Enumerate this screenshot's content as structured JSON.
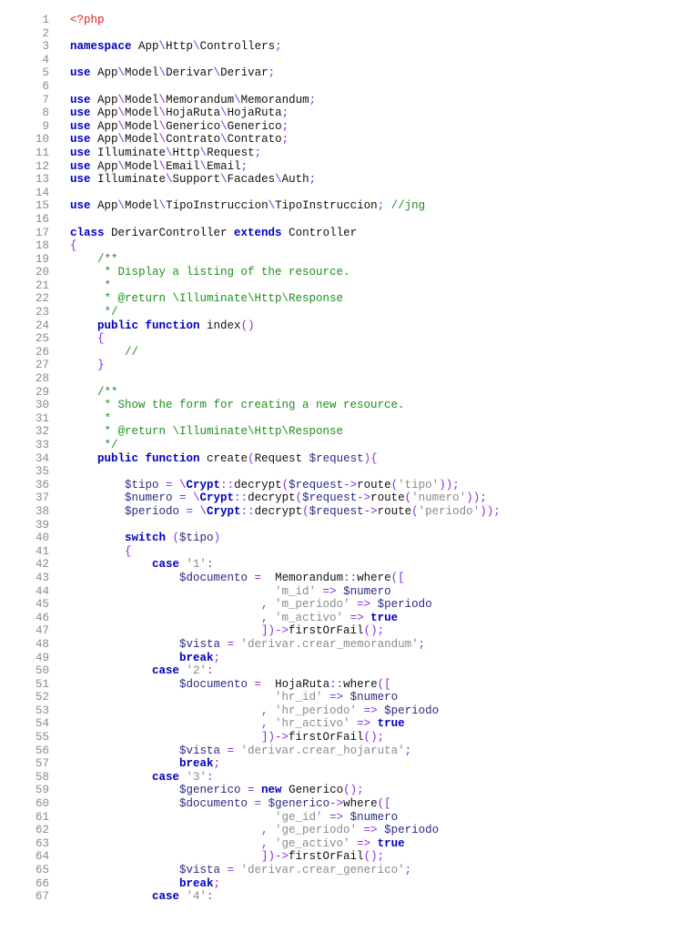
{
  "document": {
    "language": "php",
    "lines": [
      [
        [
          "h",
          "<?php"
        ]
      ],
      [],
      [
        [
          "k",
          "namespace"
        ],
        [
          "t",
          " App"
        ],
        [
          "p",
          "\\"
        ],
        [
          "t",
          "Http"
        ],
        [
          "p",
          "\\"
        ],
        [
          "t",
          "Controllers"
        ],
        [
          "p",
          ";"
        ]
      ],
      [],
      [
        [
          "k",
          "use"
        ],
        [
          "t",
          " App"
        ],
        [
          "p",
          "\\"
        ],
        [
          "t",
          "Model"
        ],
        [
          "p",
          "\\"
        ],
        [
          "t",
          "Derivar"
        ],
        [
          "p",
          "\\"
        ],
        [
          "t",
          "Derivar"
        ],
        [
          "p",
          ";"
        ]
      ],
      [],
      [
        [
          "k",
          "use"
        ],
        [
          "t",
          " App"
        ],
        [
          "p",
          "\\"
        ],
        [
          "t",
          "Model"
        ],
        [
          "p",
          "\\"
        ],
        [
          "t",
          "Memorandum"
        ],
        [
          "p",
          "\\"
        ],
        [
          "t",
          "Memorandum"
        ],
        [
          "p",
          ";"
        ]
      ],
      [
        [
          "k",
          "use"
        ],
        [
          "t",
          " App"
        ],
        [
          "p",
          "\\"
        ],
        [
          "t",
          "Model"
        ],
        [
          "p",
          "\\"
        ],
        [
          "t",
          "HojaRuta"
        ],
        [
          "p",
          "\\"
        ],
        [
          "t",
          "HojaRuta"
        ],
        [
          "p",
          ";"
        ]
      ],
      [
        [
          "k",
          "use"
        ],
        [
          "t",
          " App"
        ],
        [
          "p",
          "\\"
        ],
        [
          "t",
          "Model"
        ],
        [
          "p",
          "\\"
        ],
        [
          "t",
          "Generico"
        ],
        [
          "p",
          "\\"
        ],
        [
          "t",
          "Generico"
        ],
        [
          "p",
          ";"
        ]
      ],
      [
        [
          "k",
          "use"
        ],
        [
          "t",
          " App"
        ],
        [
          "p",
          "\\"
        ],
        [
          "t",
          "Model"
        ],
        [
          "p",
          "\\"
        ],
        [
          "t",
          "Contrato"
        ],
        [
          "p",
          "\\"
        ],
        [
          "t",
          "Contrato"
        ],
        [
          "p",
          ";"
        ]
      ],
      [
        [
          "k",
          "use"
        ],
        [
          "t",
          " Illuminate"
        ],
        [
          "p",
          "\\"
        ],
        [
          "t",
          "Http"
        ],
        [
          "p",
          "\\"
        ],
        [
          "t",
          "Request"
        ],
        [
          "p",
          ";"
        ]
      ],
      [
        [
          "k",
          "use"
        ],
        [
          "t",
          " App"
        ],
        [
          "p",
          "\\"
        ],
        [
          "t",
          "Model"
        ],
        [
          "p",
          "\\"
        ],
        [
          "t",
          "Email"
        ],
        [
          "p",
          "\\"
        ],
        [
          "t",
          "Email"
        ],
        [
          "p",
          ";"
        ]
      ],
      [
        [
          "k",
          "use"
        ],
        [
          "t",
          " Illuminate"
        ],
        [
          "p",
          "\\"
        ],
        [
          "t",
          "Support"
        ],
        [
          "p",
          "\\"
        ],
        [
          "t",
          "Facades"
        ],
        [
          "p",
          "\\"
        ],
        [
          "t",
          "Auth"
        ],
        [
          "p",
          ";"
        ]
      ],
      [],
      [
        [
          "k",
          "use"
        ],
        [
          "t",
          " App"
        ],
        [
          "p",
          "\\"
        ],
        [
          "t",
          "Model"
        ],
        [
          "p",
          "\\"
        ],
        [
          "t",
          "TipoInstruccion"
        ],
        [
          "p",
          "\\"
        ],
        [
          "t",
          "TipoInstruccion"
        ],
        [
          "p",
          "; "
        ],
        [
          "c",
          "//jng"
        ]
      ],
      [],
      [
        [
          "k",
          "class"
        ],
        [
          "t",
          " DerivarController "
        ],
        [
          "k",
          "extends"
        ],
        [
          "t",
          " Controller"
        ]
      ],
      [
        [
          "p",
          "{"
        ]
      ],
      [
        [
          "c",
          "    /**"
        ]
      ],
      [
        [
          "c",
          "     * Display a listing of the resource."
        ]
      ],
      [
        [
          "c",
          "     *"
        ]
      ],
      [
        [
          "c",
          "     * @return \\Illuminate\\Http\\Response"
        ]
      ],
      [
        [
          "c",
          "     */"
        ]
      ],
      [
        [
          "k",
          "    public"
        ],
        [
          "t",
          " "
        ],
        [
          "k",
          "function"
        ],
        [
          "t",
          " index"
        ],
        [
          "p",
          "()"
        ]
      ],
      [
        [
          "p",
          "    {"
        ]
      ],
      [
        [
          "c",
          "        //"
        ]
      ],
      [
        [
          "p",
          "    }"
        ]
      ],
      [],
      [
        [
          "c",
          "    /**"
        ]
      ],
      [
        [
          "c",
          "     * Show the form for creating a new resource."
        ]
      ],
      [
        [
          "c",
          "     *"
        ]
      ],
      [
        [
          "c",
          "     * @return \\Illuminate\\Http\\Response"
        ]
      ],
      [
        [
          "c",
          "     */"
        ]
      ],
      [
        [
          "k",
          "    public"
        ],
        [
          "t",
          " "
        ],
        [
          "k",
          "function"
        ],
        [
          "t",
          " create"
        ],
        [
          "p",
          "("
        ],
        [
          "t",
          "Request "
        ],
        [
          "v",
          "$request"
        ],
        [
          "p",
          "){"
        ]
      ],
      [],
      [
        [
          "v",
          "        $tipo"
        ],
        [
          "p",
          " = \\"
        ],
        [
          "k",
          "Crypt"
        ],
        [
          "p",
          "::"
        ],
        [
          "t",
          "decrypt"
        ],
        [
          "p",
          "("
        ],
        [
          "v",
          "$request"
        ],
        [
          "p",
          "->"
        ],
        [
          "t",
          "route"
        ],
        [
          "p",
          "("
        ],
        [
          "s",
          "'tipo'"
        ],
        [
          "p",
          "));"
        ]
      ],
      [
        [
          "v",
          "        $numero"
        ],
        [
          "p",
          " = \\"
        ],
        [
          "k",
          "Crypt"
        ],
        [
          "p",
          "::"
        ],
        [
          "t",
          "decrypt"
        ],
        [
          "p",
          "("
        ],
        [
          "v",
          "$request"
        ],
        [
          "p",
          "->"
        ],
        [
          "t",
          "route"
        ],
        [
          "p",
          "("
        ],
        [
          "s",
          "'numero'"
        ],
        [
          "p",
          "));"
        ]
      ],
      [
        [
          "v",
          "        $periodo"
        ],
        [
          "p",
          " = \\"
        ],
        [
          "k",
          "Crypt"
        ],
        [
          "p",
          "::"
        ],
        [
          "t",
          "decrypt"
        ],
        [
          "p",
          "("
        ],
        [
          "v",
          "$request"
        ],
        [
          "p",
          "->"
        ],
        [
          "t",
          "route"
        ],
        [
          "p",
          "("
        ],
        [
          "s",
          "'periodo'"
        ],
        [
          "p",
          "));"
        ]
      ],
      [],
      [
        [
          "k",
          "        switch"
        ],
        [
          "p",
          " ("
        ],
        [
          "v",
          "$tipo"
        ],
        [
          "p",
          ")"
        ]
      ],
      [
        [
          "p",
          "        {"
        ]
      ],
      [
        [
          "k",
          "            case"
        ],
        [
          "s",
          " '1'"
        ],
        [
          "p",
          ":"
        ]
      ],
      [
        [
          "v",
          "                $documento"
        ],
        [
          "p",
          " =  "
        ],
        [
          "t",
          "Memorandum"
        ],
        [
          "p",
          "::"
        ],
        [
          "t",
          "where"
        ],
        [
          "p",
          "(["
        ]
      ],
      [
        [
          "s",
          "                              'm_id'"
        ],
        [
          "p",
          " => "
        ],
        [
          "v",
          "$numero"
        ]
      ],
      [
        [
          "p",
          "                            , "
        ],
        [
          "s",
          "'m_periodo'"
        ],
        [
          "p",
          " => "
        ],
        [
          "v",
          "$periodo"
        ]
      ],
      [
        [
          "p",
          "                            , "
        ],
        [
          "s",
          "'m_activo'"
        ],
        [
          "p",
          " => "
        ],
        [
          "k",
          "true"
        ]
      ],
      [
        [
          "p",
          "                            ])->"
        ],
        [
          "t",
          "firstOrFail"
        ],
        [
          "p",
          "();"
        ]
      ],
      [
        [
          "v",
          "                $vista"
        ],
        [
          "p",
          " = "
        ],
        [
          "s",
          "'derivar.crear_memorandum'"
        ],
        [
          "p",
          ";"
        ]
      ],
      [
        [
          "k",
          "                break"
        ],
        [
          "p",
          ";"
        ]
      ],
      [
        [
          "k",
          "            case"
        ],
        [
          "s",
          " '2'"
        ],
        [
          "p",
          ":"
        ]
      ],
      [
        [
          "v",
          "                $documento"
        ],
        [
          "p",
          " =  "
        ],
        [
          "t",
          "HojaRuta"
        ],
        [
          "p",
          "::"
        ],
        [
          "t",
          "where"
        ],
        [
          "p",
          "(["
        ]
      ],
      [
        [
          "s",
          "                              'hr_id'"
        ],
        [
          "p",
          " => "
        ],
        [
          "v",
          "$numero"
        ]
      ],
      [
        [
          "p",
          "                            , "
        ],
        [
          "s",
          "'hr_periodo'"
        ],
        [
          "p",
          " => "
        ],
        [
          "v",
          "$periodo"
        ]
      ],
      [
        [
          "p",
          "                            , "
        ],
        [
          "s",
          "'hr_activo'"
        ],
        [
          "p",
          " => "
        ],
        [
          "k",
          "true"
        ]
      ],
      [
        [
          "p",
          "                            ])->"
        ],
        [
          "t",
          "firstOrFail"
        ],
        [
          "p",
          "();"
        ]
      ],
      [
        [
          "v",
          "                $vista"
        ],
        [
          "p",
          " = "
        ],
        [
          "s",
          "'derivar.crear_hojaruta'"
        ],
        [
          "p",
          ";"
        ]
      ],
      [
        [
          "k",
          "                break"
        ],
        [
          "p",
          ";"
        ]
      ],
      [
        [
          "k",
          "            case"
        ],
        [
          "s",
          " '3'"
        ],
        [
          "p",
          ":"
        ]
      ],
      [
        [
          "v",
          "                $generico"
        ],
        [
          "p",
          " = "
        ],
        [
          "k",
          "new"
        ],
        [
          "t",
          " Generico"
        ],
        [
          "p",
          "();"
        ]
      ],
      [
        [
          "v",
          "                $documento"
        ],
        [
          "p",
          " = "
        ],
        [
          "v",
          "$generico"
        ],
        [
          "p",
          "->"
        ],
        [
          "t",
          "where"
        ],
        [
          "p",
          "(["
        ]
      ],
      [
        [
          "s",
          "                              'ge_id'"
        ],
        [
          "p",
          " => "
        ],
        [
          "v",
          "$numero"
        ]
      ],
      [
        [
          "p",
          "                            , "
        ],
        [
          "s",
          "'ge_periodo'"
        ],
        [
          "p",
          " => "
        ],
        [
          "v",
          "$periodo"
        ]
      ],
      [
        [
          "p",
          "                            , "
        ],
        [
          "s",
          "'ge_activo'"
        ],
        [
          "p",
          " => "
        ],
        [
          "k",
          "true"
        ]
      ],
      [
        [
          "p",
          "                            ])->"
        ],
        [
          "t",
          "firstOrFail"
        ],
        [
          "p",
          "();"
        ]
      ],
      [
        [
          "v",
          "                $vista"
        ],
        [
          "p",
          " = "
        ],
        [
          "s",
          "'derivar.crear_generico'"
        ],
        [
          "p",
          ";"
        ]
      ],
      [
        [
          "k",
          "                break"
        ],
        [
          "p",
          ";"
        ]
      ],
      [
        [
          "k",
          "            case"
        ],
        [
          "s",
          " '4'"
        ],
        [
          "p",
          ":"
        ]
      ]
    ]
  }
}
